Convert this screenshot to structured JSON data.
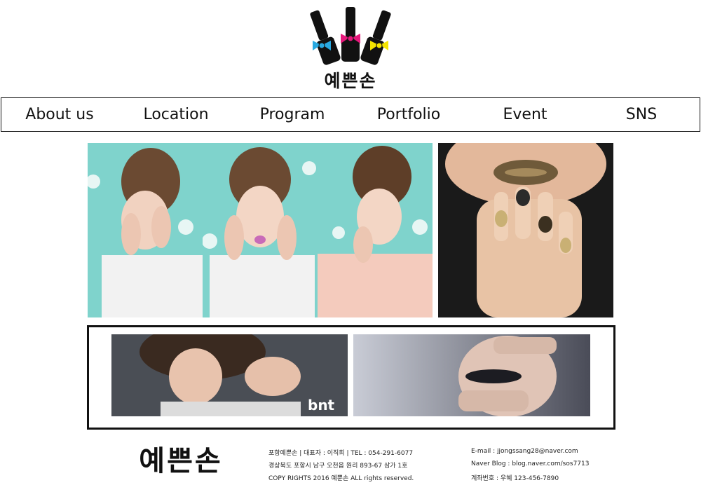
{
  "header": {
    "logo_text": "예쁜손",
    "logo_bow_colors": [
      "#29a9e1",
      "#e6197c",
      "#f5e400"
    ]
  },
  "nav": {
    "items": [
      "About us",
      "Location",
      "Program",
      "Portfolio",
      "Event",
      "SNS"
    ]
  },
  "photos": {
    "panel_colors": {
      "mint_bg": "#7fd3cc",
      "dark_bg": "#1a1a1a",
      "gray_bg": "#4a4e55"
    },
    "watermark": "bnt"
  },
  "footer": {
    "logo_text": "예쁜손",
    "line1": "포항예뿐손 | 대표자 : 이직희 | TEL : 054-291-6077",
    "line2": "경상북도 포항시 남구 오천읍 원리 893-67 삼가 1호",
    "line3": "COPY RIGHTS 2016 예뿐손 ALL rights reserved.",
    "email": "E-mail : jjongssang28@naver.com",
    "blog": "Naver Blog : blog.naver.com/sos7713",
    "account": "계좌번호 : 우혜 123-456-7890"
  }
}
